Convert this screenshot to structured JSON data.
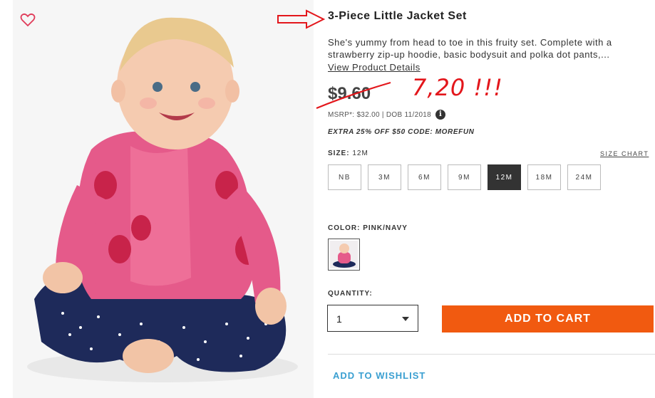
{
  "product": {
    "title": "3-Piece Little Jacket Set",
    "description": "She's yummy from head to toe in this fruity set. Complete with a strawberry zip-up hoodie, basic bodysuit and polka dot pants,...",
    "view_details_label": "View Product Details",
    "price": "$9.60",
    "annotation_price": "7,20 !!!",
    "msrp_text": "MSRP*: $32.00 | DOB 11/2018",
    "info_icon_glyph": "i",
    "promo_text": "EXTRA 25% OFF $50 CODE: MOREFUN"
  },
  "size": {
    "label": "SIZE:",
    "selected": "12M",
    "chart_link": "SIZE CHART",
    "options": [
      "NB",
      "3M",
      "6M",
      "9M",
      "12M",
      "18M",
      "24M"
    ]
  },
  "color": {
    "label": "COLOR: PINK/NAVY"
  },
  "quantity": {
    "label": "QUANTITY:",
    "value": "1"
  },
  "actions": {
    "add_to_cart": "ADD TO CART",
    "add_to_wishlist": "ADD TO WISHLIST"
  },
  "icons": {
    "favorite": "heart-icon",
    "annotation": "arrow-right-icon",
    "info": "info-icon",
    "dropdown": "chevron-down-icon"
  },
  "colors": {
    "accent_orange": "#f15a10",
    "link_blue": "#3a9fd1",
    "annotation_red": "#e3161b",
    "selected_dark": "#333333"
  }
}
